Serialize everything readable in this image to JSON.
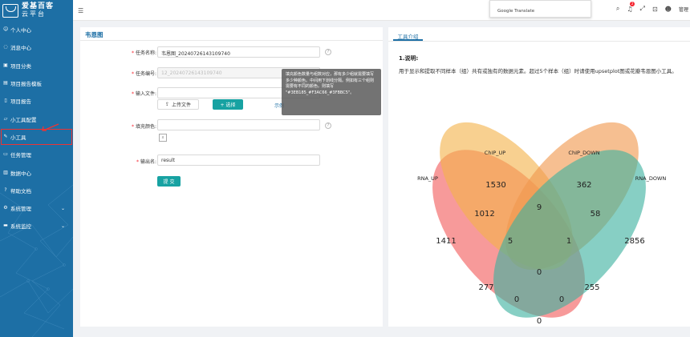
{
  "app": {
    "logo_line1": "爱基百客",
    "logo_line2": "云平台"
  },
  "sidebar": {
    "items": [
      {
        "label": "个人中心",
        "icon": "user-icon"
      },
      {
        "label": "消息中心",
        "icon": "message-icon"
      },
      {
        "label": "项目分类",
        "icon": "category-icon"
      },
      {
        "label": "项目报告模板",
        "icon": "template-icon"
      },
      {
        "label": "项目报告",
        "icon": "report-icon"
      },
      {
        "label": "小工具配置",
        "icon": "config-icon"
      },
      {
        "label": "小工具",
        "icon": "wrench-icon",
        "active": true
      },
      {
        "label": "任务管理",
        "icon": "task-icon"
      },
      {
        "label": "数据中心",
        "icon": "data-icon"
      },
      {
        "label": "帮助文档",
        "icon": "help-icon"
      },
      {
        "label": "系统管理",
        "icon": "gear-icon",
        "expandable": true
      },
      {
        "label": "系统监控",
        "icon": "monitor-icon",
        "expandable": true
      }
    ]
  },
  "topbar": {
    "translate_label": "Google Translate",
    "notification_count": "2",
    "user_label": "管理"
  },
  "form": {
    "title": "韦恩图",
    "task_name_label": "任务名称:",
    "task_name_value": "韦恩图_20240726143109740",
    "task_id_label": "任务编号:",
    "task_id_value": "12_20240726143109740",
    "input_file_label": "输入文件:",
    "upload_button": "上传文件",
    "select_button": "+ 选择",
    "example_link": "示例",
    "fill_color_label": "填充颜色:",
    "clear_label": "x",
    "output_label": "输出名:",
    "output_value": "result",
    "submit_button": "提 交",
    "tooltip": "填充颜色数量与组数对应，那有多少组就需要填写多少种颜色。中间用下划线分隔。例如有三个组则需要有不同的颜色。则填写 \"#3EB185_#F3AC66_#3FBBC5\"。"
  },
  "intro": {
    "tab_label": "工具介绍",
    "heading": "1.说明:",
    "description": "用于显示和提取不同样本（组）共有或独有的数据元素。超过5个样本（组）时请使用upsetplot图或花瓣韦恩图小工具。"
  },
  "chart_data": {
    "type": "venn",
    "sets": [
      "RNA_UP",
      "ChIP_UP",
      "ChIP_DOWN",
      "RNA_DOWN"
    ],
    "colors": {
      "RNA_UP": "#f25c5c",
      "ChIP_UP": "#f3b34c",
      "ChIP_DOWN": "#f0984e",
      "RNA_DOWN": "#3eb1a0"
    },
    "regions": [
      {
        "sets": [
          "RNA_UP"
        ],
        "value": 1411
      },
      {
        "sets": [
          "ChIP_UP"
        ],
        "value": 1530
      },
      {
        "sets": [
          "ChIP_DOWN"
        ],
        "value": 362
      },
      {
        "sets": [
          "RNA_DOWN"
        ],
        "value": 2856
      },
      {
        "sets": [
          "RNA_UP",
          "ChIP_UP"
        ],
        "value": 1012
      },
      {
        "sets": [
          "ChIP_UP",
          "ChIP_DOWN"
        ],
        "value": 9
      },
      {
        "sets": [
          "ChIP_DOWN",
          "RNA_DOWN"
        ],
        "value": 58
      },
      {
        "sets": [
          "RNA_UP",
          "ChIP_UP",
          "ChIP_DOWN"
        ],
        "value": 5
      },
      {
        "sets": [
          "ChIP_UP",
          "ChIP_DOWN",
          "RNA_DOWN"
        ],
        "value": 1
      },
      {
        "sets": [
          "RNA_UP",
          "ChIP_UP",
          "ChIP_DOWN",
          "RNA_DOWN"
        ],
        "value": 0
      },
      {
        "sets": [
          "RNA_UP",
          "ChIP_DOWN"
        ],
        "value": 277
      },
      {
        "sets": [
          "ChIP_UP",
          "RNA_DOWN"
        ],
        "value": 255
      },
      {
        "sets": [
          "RNA_UP",
          "ChIP_DOWN",
          "RNA_DOWN"
        ],
        "value": 0
      },
      {
        "sets": [
          "RNA_UP",
          "ChIP_UP",
          "RNA_DOWN"
        ],
        "value": 0
      },
      {
        "sets": [
          "RNA_UP",
          "RNA_DOWN"
        ],
        "value": 0
      }
    ]
  }
}
